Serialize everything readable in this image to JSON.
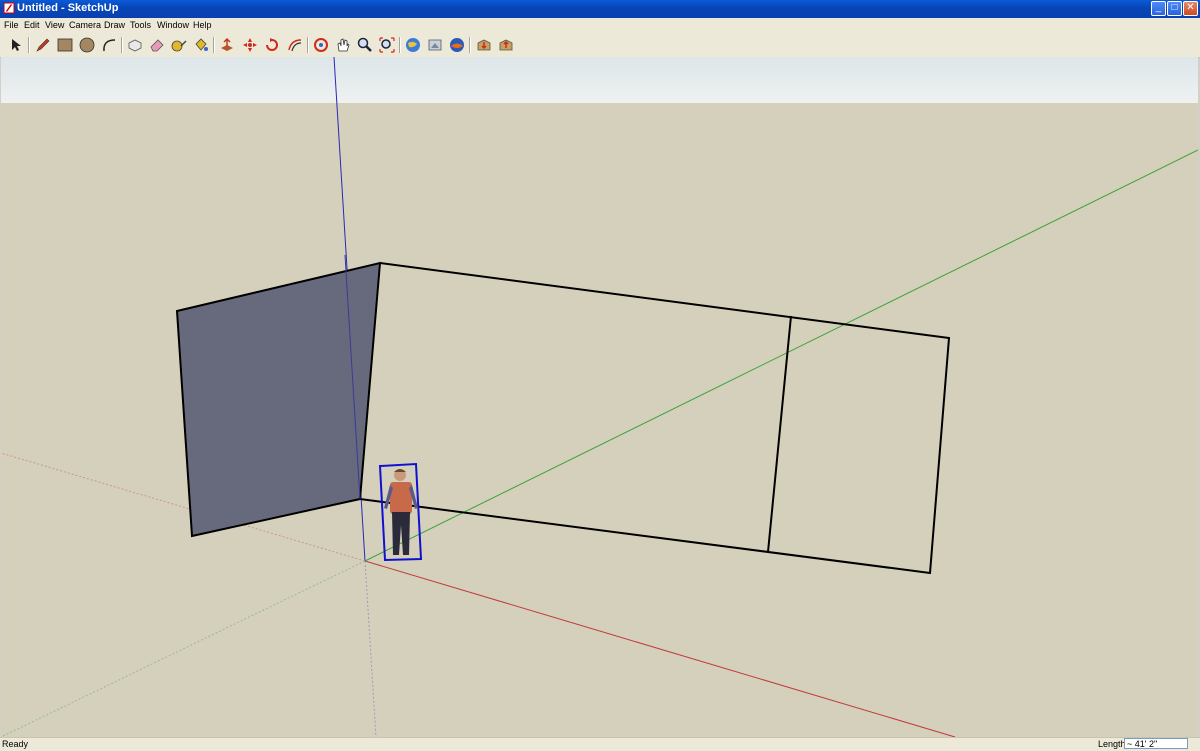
{
  "window": {
    "title": "Untitled - SketchUp",
    "controls": {
      "minimize": "_",
      "maximize": "□",
      "close": "✕"
    }
  },
  "menu": {
    "items": [
      {
        "label": "File"
      },
      {
        "label": "Edit"
      },
      {
        "label": "View"
      },
      {
        "label": "Camera"
      },
      {
        "label": "Draw"
      },
      {
        "label": "Tools"
      },
      {
        "label": "Window"
      },
      {
        "label": "Help"
      }
    ]
  },
  "toolbar": {
    "tools": [
      "select-icon",
      "pencil-icon",
      "rectangle-icon",
      "circle-icon",
      "arc-icon",
      "make-component-icon",
      "eraser-icon",
      "tape-measure-icon",
      "paint-bucket-icon",
      "push-pull-icon",
      "move-icon",
      "rotate-icon",
      "offset-icon",
      "orbit-icon",
      "pan-icon",
      "zoom-icon",
      "zoom-extents-icon",
      "get-models-icon",
      "share-model-icon",
      "google-earth-icon",
      "warehouse-get-icon",
      "warehouse-share-icon"
    ]
  },
  "status": {
    "text": "Ready",
    "measure_label": "Length",
    "measure_value": "~ 41' 2\""
  },
  "colors": {
    "ground": "#d4d0bb",
    "shaded_face": "#676a7c",
    "red_axis": "#c23a3a",
    "green_axis": "#3aa33a",
    "blue_axis": "#2a2ab5",
    "selection": "#1010d0"
  }
}
